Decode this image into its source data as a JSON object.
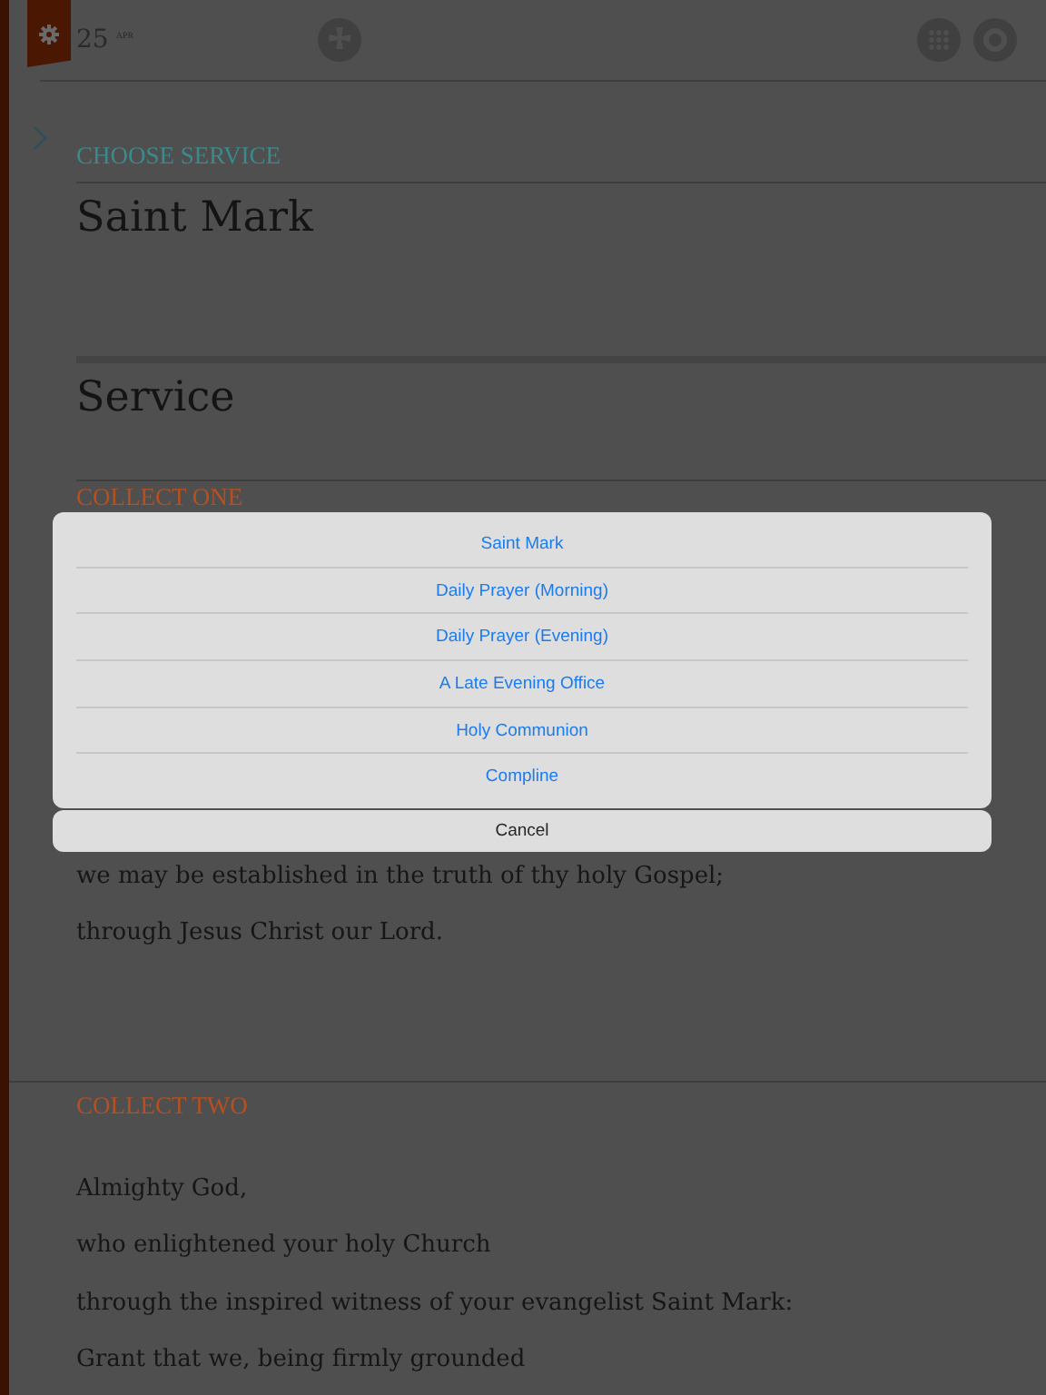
{
  "date": {
    "day": "25",
    "month": "APR"
  },
  "choose_service": {
    "label": "CHOOSE SERVICE",
    "title": "Saint Mark"
  },
  "section_title": "Service",
  "collects": [
    {
      "heading": "COLLECT ONE",
      "lines": [
        "we may be established in the truth of thy holy Gospel;",
        "through Jesus Christ our Lord."
      ]
    },
    {
      "heading": "COLLECT TWO",
      "lines": [
        "Almighty God,",
        "who enlightened your holy Church",
        "through the inspired witness of your evangelist Saint Mark:",
        "Grant that we, being firmly grounded"
      ]
    }
  ],
  "action_sheet": {
    "options": [
      "Saint Mark",
      "Daily Prayer (Morning)",
      "Daily Prayer (Evening)",
      "A Late Evening Office",
      "Holy Communion",
      "Compline"
    ],
    "cancel": "Cancel"
  }
}
